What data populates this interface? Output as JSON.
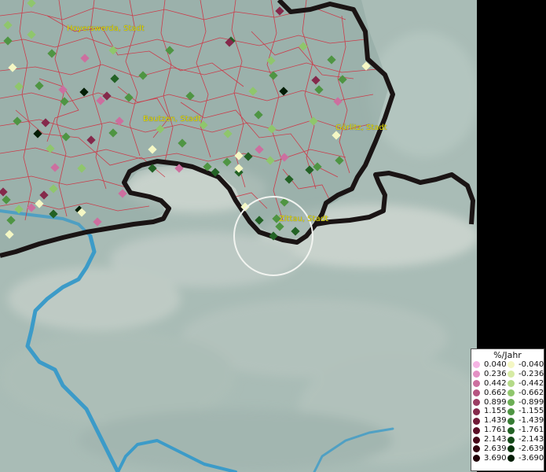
{
  "places": {
    "hoyerswerda": "Hoyerswerda, Stadt",
    "bautzen": "Bautzen, Stadt",
    "goerlitz": "Görlitz, Stadt",
    "zittau": "Zittau, Stadt"
  },
  "legend": {
    "title": "%/Jahr",
    "positive": [
      {
        "value": "0.040",
        "color": "#f6b4e4"
      },
      {
        "value": "0.236",
        "color": "#e490c4"
      },
      {
        "value": "0.442",
        "color": "#cc6f9f"
      },
      {
        "value": "0.662",
        "color": "#b65480"
      },
      {
        "value": "0.899",
        "color": "#9c3d63"
      },
      {
        "value": "1.155",
        "color": "#85294b"
      },
      {
        "value": "1.439",
        "color": "#701a37"
      },
      {
        "value": "1.761",
        "color": "#5b0e26"
      },
      {
        "value": "2.143",
        "color": "#470719"
      },
      {
        "value": "2.639",
        "color": "#33030f"
      },
      {
        "value": "3.690",
        "color": "#200106"
      }
    ],
    "negative": [
      {
        "value": "-0.040",
        "color": "#f4f7c4"
      },
      {
        "value": "-0.236",
        "color": "#d6eba4"
      },
      {
        "value": "-0.442",
        "color": "#b4da88"
      },
      {
        "value": "-0.662",
        "color": "#8fc66c"
      },
      {
        "value": "-0.899",
        "color": "#6cae55"
      },
      {
        "value": "-1.155",
        "color": "#4f9543"
      },
      {
        "value": "-1.439",
        "color": "#367b33"
      },
      {
        "value": "-1.761",
        "color": "#236225"
      },
      {
        "value": "-2.143",
        "color": "#144a18"
      },
      {
        "value": "-2.639",
        "color": "#09340d"
      },
      {
        "value": "-3.690",
        "color": "#031d05"
      }
    ]
  }
}
